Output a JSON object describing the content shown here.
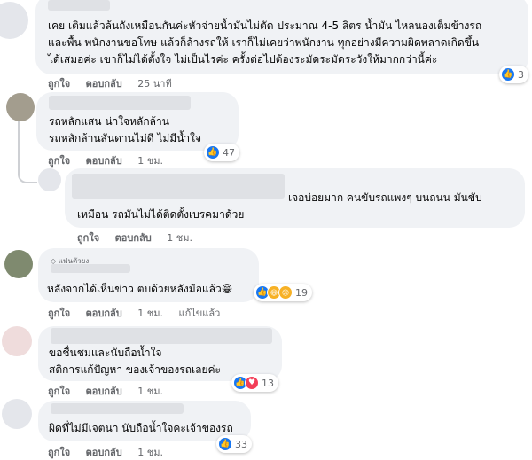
{
  "comments": [
    {
      "lines": [
        "เคย เติมแล้วล้นถังเหมือนกันค่ะหัวจ่ายน้ำมันไม่ตัด ประมาณ 4-5 ลิตร น้ำมัน ไหลนองเต็มข้างรถ",
        "และพื้น พนักงานขอโทษ แล้วก็ล้างรถให้ เราก็ไม่เคยว่าพนักงาน ทุกอย่างมีความผิดพลาดเกิดขึ้น",
        "ได้เสมอค่ะ เขาก็ไม่ได้ตั้งใจ ไม่เป็นไรค่ะ ครั้งต่อไปต้องระมัดระมัดระวังให้มากกว่านี้ค่ะ"
      ],
      "like": "ถูกใจ",
      "reply": "ตอบกลับ",
      "time": "25 นาที",
      "reaction_count": "3"
    },
    {
      "lines": [
        "รถหลักแสน น่าใจหลักล้าน",
        "รถหลักล้านสันดานไม่ดี ไม่มีน้ำใจ"
      ],
      "like": "ถูกใจ",
      "reply": "ตอบกลับ",
      "time": "1 ชม.",
      "reaction_count": "47"
    },
    {
      "lines": [
        "เจอบ่อยมาก คนขับรถแพงๆ บนถนน มันขับ",
        "เหมือน รถมันไม่ได้ติดตั้งเบรคมาด้วย"
      ],
      "like": "ถูกใจ",
      "reply": "ตอบกลับ",
      "time": "1 ชม."
    },
    {
      "badge": "แฟนตัวยง",
      "lines": [
        "หลังจากได้เห็นข่าว ตบด้วยหลังมือแล้ว😁"
      ],
      "like": "ถูกใจ",
      "reply": "ตอบกลับ",
      "time": "1 ชม.",
      "edited": "แก้ไขแล้ว",
      "reaction_count": "19"
    },
    {
      "lines": [
        "ขอชื่นชมและนับถือน้ำใจ",
        "สติการแก้ปัญหา ของเจ้าของรถเลยค่ะ"
      ],
      "like": "ถูกใจ",
      "reply": "ตอบกลับ",
      "time": "1 ชม.",
      "reaction_count": "13"
    },
    {
      "lines": [
        "ผิดที่ไม่มีเจตนา นับถือน้ำใจคะเจ้าของรถ"
      ],
      "like": "ถูกใจ",
      "reply": "ตอบกลับ",
      "time": "1 ชม.",
      "reaction_count": "33"
    }
  ],
  "colors": {
    "bubble": "#f0f2f5",
    "like_blue": "#1877f2",
    "meta_gray": "#65676b"
  }
}
